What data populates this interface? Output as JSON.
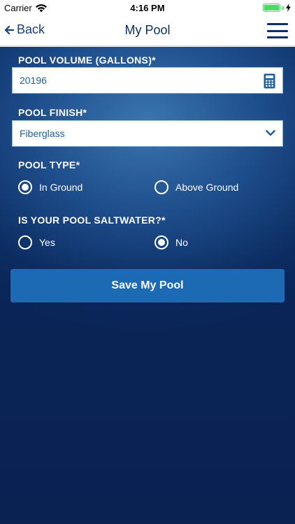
{
  "status_bar": {
    "carrier": "Carrier",
    "time": "4:16 PM"
  },
  "nav": {
    "back_label": "Back",
    "title": "My Pool"
  },
  "form": {
    "pool_volume": {
      "label": "POOL VOLUME (GALLONS)*",
      "value": "20196"
    },
    "pool_finish": {
      "label": "POOL FINISH*",
      "value": "Fiberglass"
    },
    "pool_type": {
      "label": "POOL TYPE*",
      "options": [
        "In Ground",
        "Above Ground"
      ],
      "selected": "In Ground"
    },
    "saltwater": {
      "label": "IS YOUR POOL SALTWATER?*",
      "options": [
        "Yes",
        "No"
      ],
      "selected": "No"
    },
    "save_label": "Save My Pool"
  },
  "colors": {
    "accent": "#1c69b4",
    "nav_text": "#0d2e66",
    "battery": "#4cd964"
  }
}
